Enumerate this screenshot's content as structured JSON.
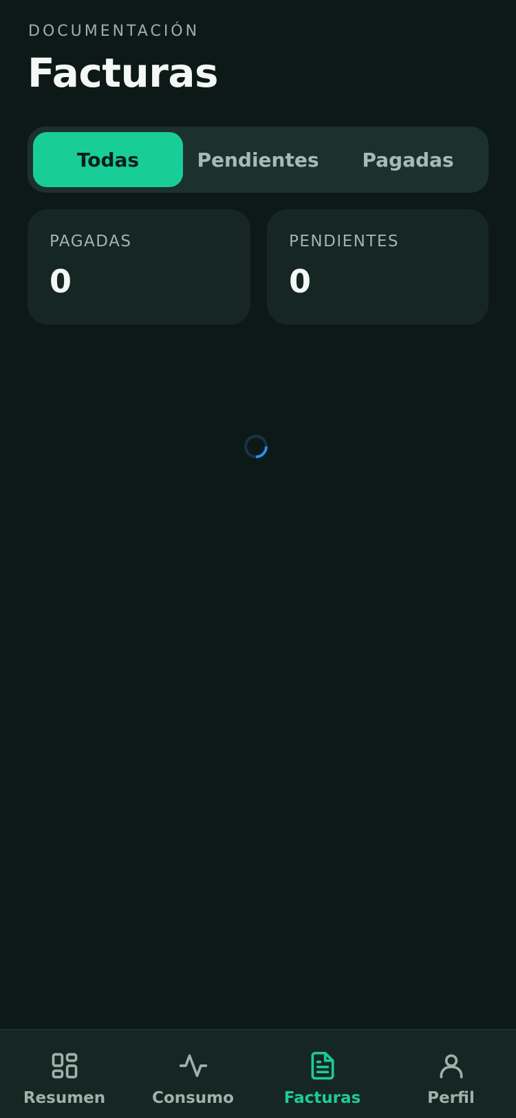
{
  "header": {
    "eyebrow": "DOCUMENTACIÓN",
    "title": "Facturas"
  },
  "filter_tabs": [
    {
      "label": "Todas",
      "active": true
    },
    {
      "label": "Pendientes",
      "active": false
    },
    {
      "label": "Pagadas",
      "active": false
    }
  ],
  "stats": {
    "paid": {
      "label": "PAGADAS",
      "value": "0"
    },
    "pending": {
      "label": "PENDIENTES",
      "value": "0"
    }
  },
  "loading_indicator": "spinner-icon",
  "bottom_nav": [
    {
      "label": "Resumen",
      "icon": "grid-icon",
      "active": false
    },
    {
      "label": "Consumo",
      "icon": "activity-icon",
      "active": false
    },
    {
      "label": "Facturas",
      "icon": "document-icon",
      "active": true
    },
    {
      "label": "Perfil",
      "icon": "user-icon",
      "active": false
    }
  ],
  "colors": {
    "background": "#0d1917",
    "accent": "#19cd98",
    "card": "#162623",
    "segment_bg": "#1c312d",
    "muted_text": "#9fb1ab",
    "spinner": "#2c8df0"
  }
}
